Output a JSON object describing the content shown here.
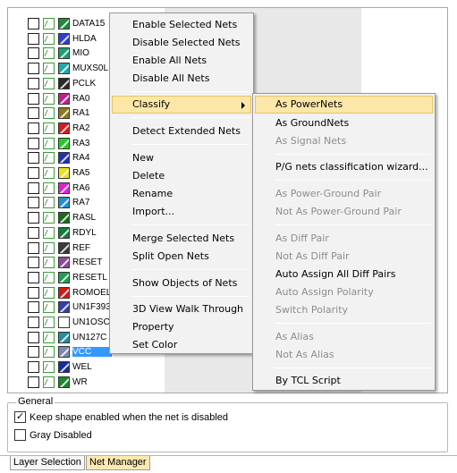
{
  "net_list": [
    {
      "name": "DATA15",
      "color": "#1f8a3a"
    },
    {
      "name": "HLDA",
      "color": "#2a3fd6"
    },
    {
      "name": "MIO",
      "color": "#1aa070"
    },
    {
      "name": "MUXS0L",
      "color": "#20a8a8"
    },
    {
      "name": "PCLK",
      "color": "#2a2a2a"
    },
    {
      "name": "RA0",
      "color": "#c0208a"
    },
    {
      "name": "RA1",
      "color": "#8a7a1a"
    },
    {
      "name": "RA2",
      "color": "#d91a1a"
    },
    {
      "name": "RA3",
      "color": "#22cc22"
    },
    {
      "name": "RA4",
      "color": "#2030b8"
    },
    {
      "name": "RA5",
      "color": "#e8e020"
    },
    {
      "name": "RA6",
      "color": "#e020d0"
    },
    {
      "name": "RA7",
      "color": "#2090d0"
    },
    {
      "name": "RASL",
      "color": "#1a6a1a"
    },
    {
      "name": "RDYL",
      "color": "#1a7a3a"
    },
    {
      "name": "REF",
      "color": "#3a3a3a"
    },
    {
      "name": "RESET",
      "color": "#8a4a9a"
    },
    {
      "name": "RESETL",
      "color": "#1aa050"
    },
    {
      "name": "ROMOEL",
      "color": "#d01a1a"
    },
    {
      "name": "UN1F393",
      "color": "#3040b0"
    },
    {
      "name": "UN1OSC",
      "color": "#ffffff"
    },
    {
      "name": "UN127C",
      "color": "#2090a0"
    },
    {
      "name": "VCC",
      "color": "#7a8ab0",
      "selected": true
    },
    {
      "name": "WEL",
      "color": "#1a2aa0"
    },
    {
      "name": "WR",
      "color": "#1a8a2a"
    }
  ],
  "context_menu": {
    "items": [
      {
        "label": "Enable Selected Nets"
      },
      {
        "label": "Disable Selected Nets"
      },
      {
        "label": "Enable All Nets"
      },
      {
        "label": "Disable All Nets"
      },
      {
        "label": "Classify",
        "highlighted": true,
        "has_submenu": true
      },
      {
        "label": "Detect Extended Nets"
      },
      {
        "label": "New"
      },
      {
        "label": "Delete"
      },
      {
        "label": "Rename"
      },
      {
        "label": "Import..."
      },
      {
        "label": "Merge Selected Nets"
      },
      {
        "label": "Split Open Nets"
      },
      {
        "label": "Show Objects of Nets"
      },
      {
        "label": "3D View Walk Through"
      },
      {
        "label": "Property"
      },
      {
        "label": "Set Color"
      }
    ]
  },
  "classify_submenu": {
    "items": [
      {
        "label": "As PowerNets",
        "highlighted": true
      },
      {
        "label": "As GroundNets"
      },
      {
        "label": "As Signal Nets",
        "disabled": true
      },
      {
        "label": "P/G nets classification wizard..."
      },
      {
        "label": "As Power-Ground Pair",
        "disabled": true
      },
      {
        "label": "Not As Power-Ground Pair",
        "disabled": true
      },
      {
        "label": "As Diff Pair",
        "disabled": true
      },
      {
        "label": "Not As Diff Pair",
        "disabled": true
      },
      {
        "label": "Auto Assign All Diff Pairs"
      },
      {
        "label": "Auto Assign Polarity",
        "disabled": true
      },
      {
        "label": "Switch Polarity",
        "disabled": true
      },
      {
        "label": "As Alias",
        "disabled": true
      },
      {
        "label": "Not As Alias",
        "disabled": true
      },
      {
        "label": "By TCL Script"
      }
    ]
  },
  "general": {
    "title": "General",
    "keep_shape_label": "Keep shape enabled when the net is disabled",
    "keep_shape_checked": true,
    "gray_disabled_label": "Gray Disabled",
    "gray_disabled_checked": false
  },
  "tabs": {
    "layer_selection": "Layer Selection",
    "net_manager": "Net Manager"
  }
}
